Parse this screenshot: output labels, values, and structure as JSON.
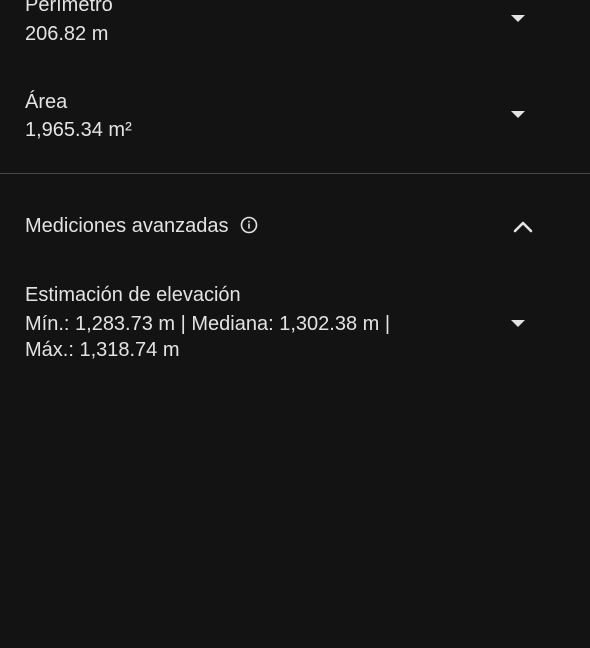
{
  "perimeter": {
    "title": "Perímetro",
    "value": "206.82 m"
  },
  "area": {
    "title": "Área",
    "value": "1,965.34 m²"
  },
  "advanced": {
    "title": "Mediciones avanzadas"
  },
  "elevation": {
    "title": "Estimación de elevación",
    "line1": "Mín.: 1,283.73 m | Mediana: 1,302.38 m |",
    "line2": "Máx.: 1,318.74 m"
  },
  "colors": {
    "background": "#131314",
    "text": "#e3e3e3",
    "divider": "#444746"
  },
  "icons": {
    "expand": "caret-down-icon",
    "collapse": "chevron-up-icon",
    "info": "info-icon"
  }
}
